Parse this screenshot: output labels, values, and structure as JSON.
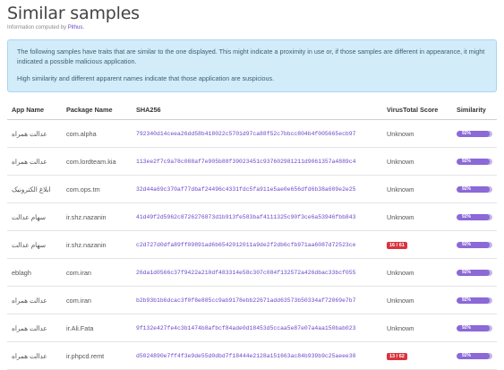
{
  "page": {
    "title": "Similar samples",
    "computed_prefix": "Information computed by ",
    "computed_by": "Pithus.",
    "info_p1": "The following samples have traits that are similar to the one displayed. This might indicate a proximity in use or, if those samples are different in appearance, it might indicated a possible malicious application.",
    "info_p2": "High similarity and different apparent names indicate that those application are suspicious."
  },
  "table": {
    "headers": {
      "app_name": "App Name",
      "package_name": "Package Name",
      "sha256": "SHA256",
      "virustotal": "VirusTotal Score",
      "similarity": "Similarity"
    },
    "rows": [
      {
        "app_name": "عدالت همراه",
        "package": "com.alpha",
        "sha256": "792340d14ceea26dd58b418022c5701d97ca88f52c7bbcc804b4f005665ecb97",
        "vt": "Unknown",
        "vt_flag": false,
        "similarity_pct": 92,
        "similarity_label": "92%"
      },
      {
        "app_name": "عدالت همراه",
        "package": "com.lordteam.kia",
        "sha256": "113ee2f7c9a78c088af7e905b88f39023451c937602981211d9061357a4889c4",
        "vt": "Unknown",
        "vt_flag": false,
        "similarity_pct": 92,
        "similarity_label": "92%"
      },
      {
        "app_name": "ابلاغ الکترونیک",
        "package": "com.ops.tm",
        "sha256": "32d44a69c370af77dbaf24496c4331fdc5fa911e5ae0e656dfd6b38a609e2e25",
        "vt": "Unknown",
        "vt_flag": false,
        "similarity_pct": 92,
        "similarity_label": "92%"
      },
      {
        "app_name": "سهام عدالت",
        "package": "ir.shz.nazanin",
        "sha256": "41d49f2d5962c8726276873d1b913fe583baf4111325c90f3ce6a53946fbb843",
        "vt": "Unknown",
        "vt_flag": false,
        "similarity_pct": 92,
        "similarity_label": "92%"
      },
      {
        "app_name": "سهام عدالت",
        "package": "ir.shz.nazanin",
        "sha256": "c2d727d0dfa89ff09891ad6b6542012011a9de2f2db6cfb971aa6087d72523ce",
        "vt": "16 / 61",
        "vt_flag": true,
        "similarity_pct": 92,
        "similarity_label": "92%"
      },
      {
        "app_name": "eblagh",
        "package": "com.iran",
        "sha256": "26da1d0566c37f9422a210df483314e58c307c084f132572a426dbac33bcf055",
        "vt": "Unknown",
        "vt_flag": false,
        "similarity_pct": 92,
        "similarity_label": "92%"
      },
      {
        "app_name": "عدالت همراه",
        "package": "com.iran",
        "sha256": "b2b93b1b6dcac3f0f8e885cc9ab9178ebb22671add63573b50334af72069e7b7",
        "vt": "Unknown",
        "vt_flag": false,
        "similarity_pct": 92,
        "similarity_label": "92%"
      },
      {
        "app_name": "عدالت همراه",
        "package": "ir.Ali.Fata",
        "sha256": "9f132e427fe4c3b1474b8afbcf84ade0d18453d5ccaa5e87e07a4aa150bab023",
        "vt": "Unknown",
        "vt_flag": false,
        "similarity_pct": 92,
        "similarity_label": "92%"
      },
      {
        "app_name": "عدالت همراه",
        "package": "ir.phpcd.remt",
        "sha256": "d5024890e7ff4f3e9de55d0dbd7f18444e2128a151663ac84b939b9c25aeee30",
        "vt": "13 / 62",
        "vt_flag": true,
        "similarity_pct": 92,
        "similarity_label": "92%"
      }
    ]
  },
  "colors": {
    "accent": "#6a47c8",
    "info_bg": "#d3ecfa",
    "vt_badge": "#d9343e",
    "bar_fill": "#8b69d6",
    "bar_bg": "#c6b6e9"
  }
}
